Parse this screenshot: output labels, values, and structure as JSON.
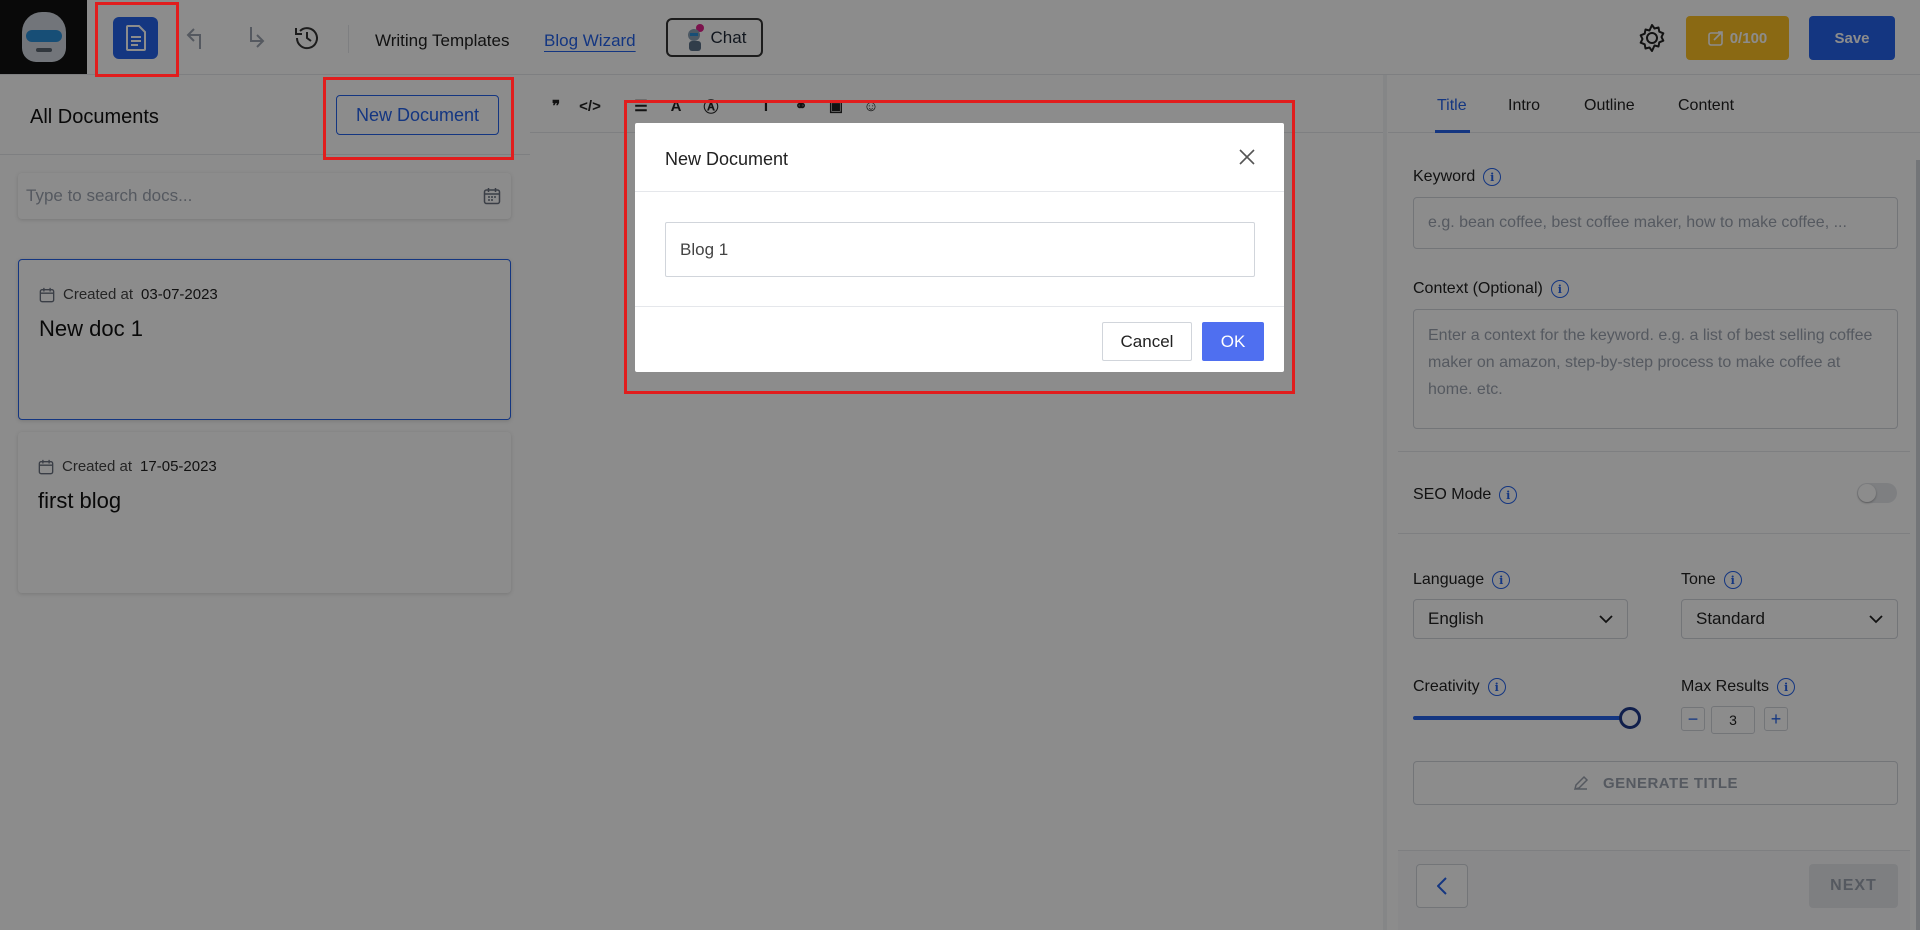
{
  "topbar": {
    "links": [
      "Writing Templates",
      "Blog Wizard"
    ],
    "chat_label": "Chat",
    "credits": "0/100",
    "save_label": "Save"
  },
  "left": {
    "heading": "All Documents",
    "new_document_label": "New Document",
    "search_placeholder": "Type to search docs...",
    "docs": [
      {
        "created_prefix": "Created at",
        "date": "03-07-2023",
        "title": "New doc 1",
        "selected": true
      },
      {
        "created_prefix": "Created at",
        "date": "17-05-2023",
        "title": "first blog",
        "selected": false
      }
    ]
  },
  "right": {
    "tabs": [
      "Title",
      "Intro",
      "Outline",
      "Content"
    ],
    "active_tab": "Title",
    "keyword_label": "Keyword",
    "keyword_placeholder": "e.g. bean coffee, best coffee maker, how to make coffee, ...",
    "context_label": "Context (Optional)",
    "context_placeholder": "Enter a context for the keyword. e.g. a list of best selling coffee maker on amazon, step-by-step process to make coffee at home. etc.",
    "seo_label": "SEO Mode",
    "seo_enabled": false,
    "language_label": "Language",
    "language_value": "English",
    "tone_label": "Tone",
    "tone_value": "Standard",
    "creativity_label": "Creativity",
    "creativity_level": 0.95,
    "max_results_label": "Max Results",
    "max_results_value": "3",
    "generate_label": "GENERATE TITLE",
    "next_label": "NEXT"
  },
  "modal": {
    "title": "New Document",
    "input_value": "Blog 1",
    "cancel_label": "Cancel",
    "ok_label": "OK"
  },
  "colors": {
    "primary": "#2563eb",
    "credits": "#fbbf24",
    "highlight": "#e11d1d",
    "ok": "#4f6ff0"
  }
}
